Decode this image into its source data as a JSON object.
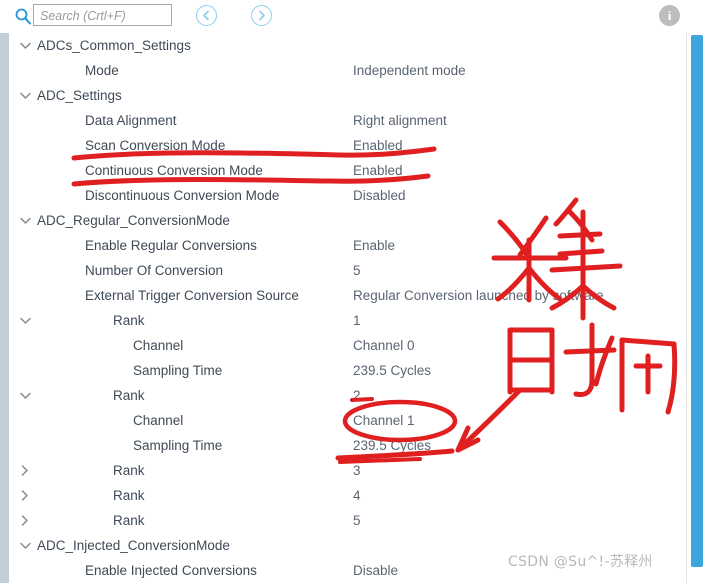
{
  "toolbar": {
    "search_placeholder": "Search (Crtl+F)",
    "search_value": "",
    "search_icon": "search-icon",
    "back_icon": "chevron-left-circle-icon",
    "forward_icon": "chevron-right-circle-icon",
    "info_icon": "info-icon",
    "info_glyph": "i"
  },
  "tree": {
    "rows": [
      {
        "label": "ADCs_Common_Settings",
        "value": "",
        "level": 0,
        "twisty": "expanded"
      },
      {
        "label": "Mode",
        "value": "Independent mode",
        "level": 1,
        "twisty": "none"
      },
      {
        "label": "ADC_Settings",
        "value": "",
        "level": 0,
        "twisty": "expanded"
      },
      {
        "label": "Data Alignment",
        "value": "Right alignment",
        "level": 1,
        "twisty": "none"
      },
      {
        "label": "Scan Conversion Mode",
        "value": "Enabled",
        "level": 1,
        "twisty": "none"
      },
      {
        "label": "Continuous Conversion Mode",
        "value": "Enabled",
        "level": 1,
        "twisty": "none"
      },
      {
        "label": "Discontinuous Conversion Mode",
        "value": "Disabled",
        "level": 1,
        "twisty": "none"
      },
      {
        "label": "ADC_Regular_ConversionMode",
        "value": "",
        "level": 0,
        "twisty": "expanded"
      },
      {
        "label": "Enable Regular Conversions",
        "value": "Enable",
        "level": 1,
        "twisty": "none"
      },
      {
        "label": "Number Of Conversion",
        "value": "5",
        "level": 1,
        "twisty": "none"
      },
      {
        "label": "External Trigger Conversion Source",
        "value": "Regular Conversion launched by software",
        "level": 1,
        "twisty": "none"
      },
      {
        "label": "Rank",
        "value": "1",
        "level": 2,
        "twisty": "expanded"
      },
      {
        "label": "Channel",
        "value": "Channel 0",
        "level": 3,
        "twisty": "none"
      },
      {
        "label": "Sampling Time",
        "value": "239.5 Cycles",
        "level": 3,
        "twisty": "none"
      },
      {
        "label": "Rank",
        "value": "2",
        "level": 2,
        "twisty": "expanded"
      },
      {
        "label": "Channel",
        "value": "Channel 1",
        "level": 3,
        "twisty": "none"
      },
      {
        "label": "Sampling Time",
        "value": "239.5 Cycles",
        "level": 3,
        "twisty": "none"
      },
      {
        "label": "Rank",
        "value": "3",
        "level": 2,
        "twisty": "collapsed"
      },
      {
        "label": "Rank",
        "value": "4",
        "level": 2,
        "twisty": "collapsed"
      },
      {
        "label": "Rank",
        "value": "5",
        "level": 2,
        "twisty": "collapsed"
      },
      {
        "label": "ADC_Injected_ConversionMode",
        "value": "",
        "level": 0,
        "twisty": "expanded"
      },
      {
        "label": "Enable Injected Conversions",
        "value": "Disable",
        "level": 1,
        "twisty": "none"
      }
    ]
  },
  "scrollbar": {
    "orientation": "vertical",
    "thumb_color": "#3aa6dd"
  },
  "annotations": {
    "ink_color": "#e02020",
    "handwritten_note_top": "采集",
    "handwritten_note_bottom": "时间",
    "marks": [
      "underline-scan-conversion-mode",
      "underline-continuous-conversion-mode",
      "ellipse-channel-1",
      "arrow-to-channel-1",
      "underline-sampling-time-rank2"
    ]
  },
  "watermark": {
    "text": "CSDN @Su^!-苏释州"
  }
}
